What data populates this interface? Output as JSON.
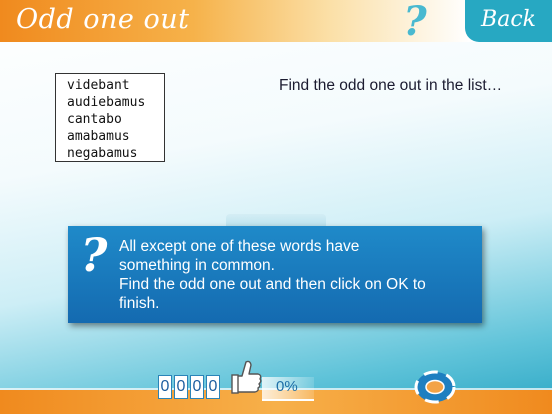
{
  "header": {
    "title": "Odd one out",
    "help_glyph": "?",
    "back_label": "Back"
  },
  "word_list": [
    "videbant",
    "audiebamus",
    "cantabo",
    "amabamus",
    "negabamus"
  ],
  "instruction": "Find the odd one out in the list…",
  "dialog": {
    "icon": "?",
    "lines": [
      "All except one of these words have",
      "something in common.",
      "Find the odd one out and then click on OK to",
      "finish."
    ]
  },
  "footer": {
    "score_digits": [
      "0",
      "0",
      "0",
      "0"
    ],
    "progress_text": "0%",
    "progress_value": 0,
    "thumb_icon": "thumbs-up-icon",
    "help_icon": "lifebuoy-icon"
  },
  "colors": {
    "accent_orange": "#f08a1e",
    "accent_teal": "#27a8c2",
    "dialog_blue": "#1778bd"
  }
}
